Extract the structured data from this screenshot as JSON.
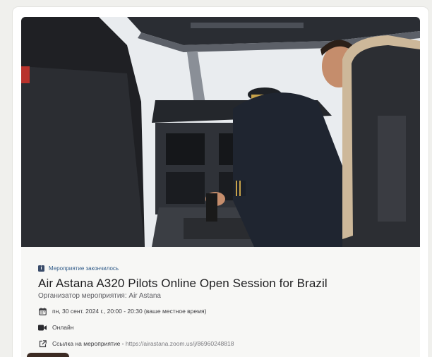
{
  "event": {
    "status_label": "Мероприятие закончилось",
    "title": "Air Astana A320 Pilots Online Open Session for Brazil",
    "organizer": "Организатор мероприятия: Air Astana",
    "datetime": "пн, 30 сент. 2024 г., 20:00 - 20:30 (ваше местное время)",
    "format": "Онлайн",
    "link_label": "Ссылка на мероприятие - ",
    "link_url": "https://airastana.zoom.us/j/86960248818"
  },
  "icons": {
    "status": "info-icon",
    "date": "calendar-icon",
    "format": "video-camera-icon",
    "link": "external-link-icon"
  },
  "colors": {
    "status_text": "#2f5a88",
    "title": "#1d1d1f",
    "link_url": "#7a7a7f"
  }
}
